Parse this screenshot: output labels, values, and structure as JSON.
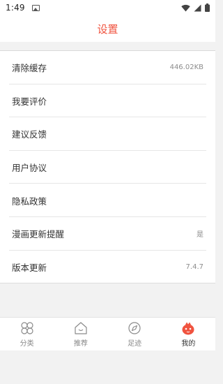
{
  "status_bar": {
    "time": "1:49"
  },
  "header": {
    "title": "设置"
  },
  "settings": [
    {
      "label": "清除缓存",
      "value": "446.02KB"
    },
    {
      "label": "我要评价",
      "value": ""
    },
    {
      "label": "建议反馈",
      "value": ""
    },
    {
      "label": "用户协议",
      "value": ""
    },
    {
      "label": "隐私政策",
      "value": ""
    },
    {
      "label": "漫画更新提醒",
      "value": "是"
    },
    {
      "label": "版本更新",
      "value": "7.4.7"
    }
  ],
  "tabbar": {
    "tabs": [
      {
        "label": "分类",
        "icon": "category-icon"
      },
      {
        "label": "推荐",
        "icon": "home-icon"
      },
      {
        "label": "足迹",
        "icon": "compass-icon"
      },
      {
        "label": "我的",
        "icon": "mascot-icon"
      }
    ],
    "active_index": 3
  },
  "colors": {
    "accent": "#f0533f",
    "background": "#f2f2f2"
  }
}
